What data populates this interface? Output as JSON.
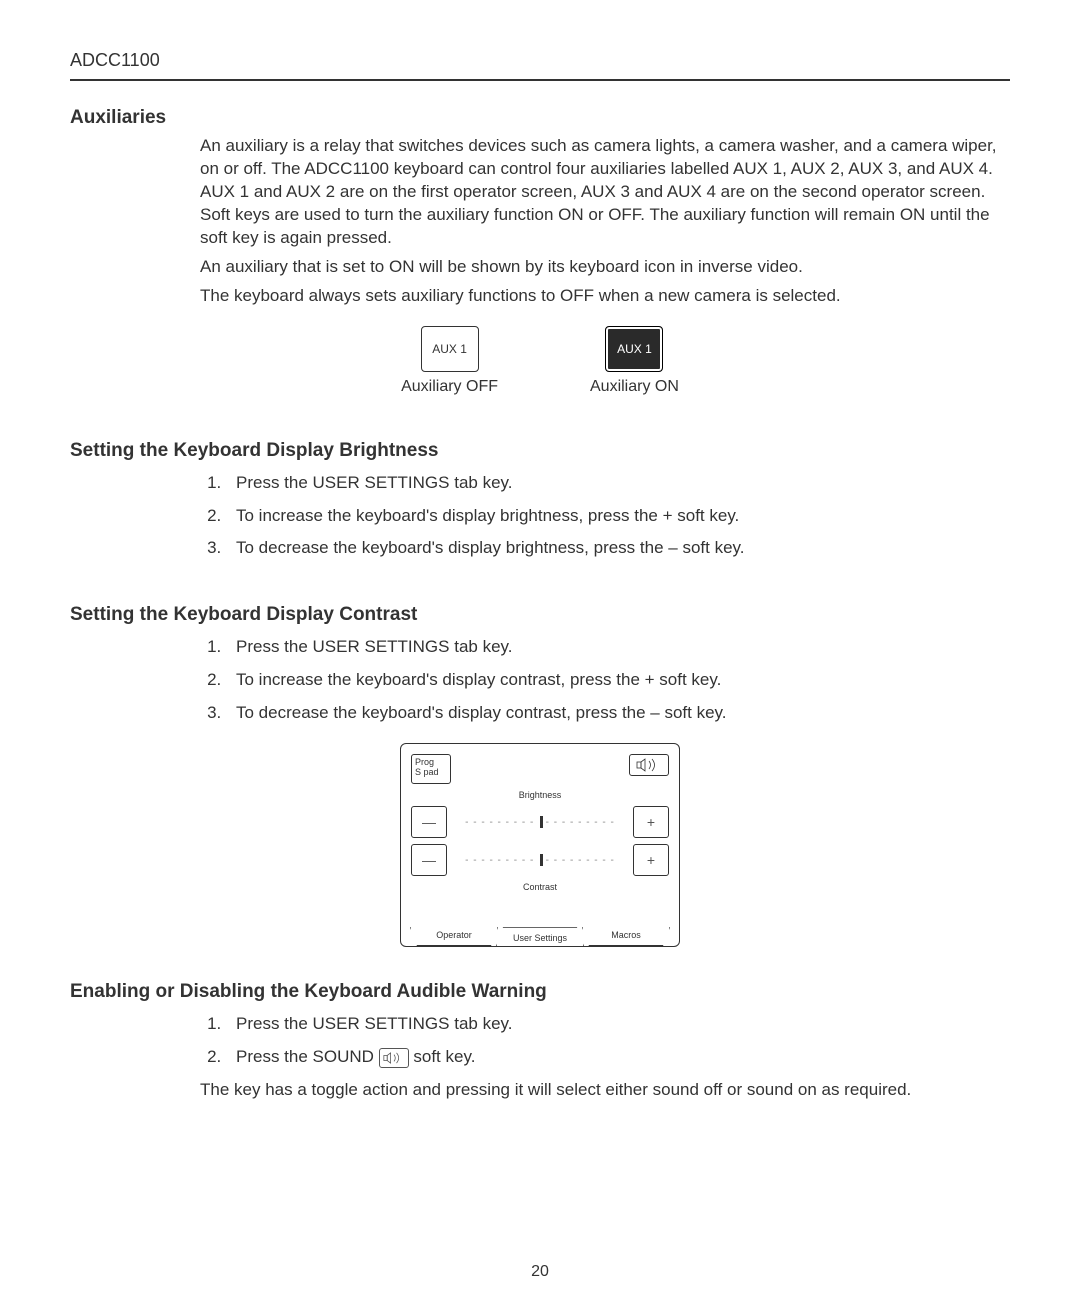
{
  "header": {
    "doc_id": "ADCC1100"
  },
  "page_number": "20",
  "sections": {
    "aux": {
      "title": "Auxiliaries",
      "p1": "An auxiliary is a relay that switches devices such as camera lights, a camera washer, and a camera wiper, on or off. The ADCC1100 keyboard can control four auxiliaries labelled AUX 1, AUX 2, AUX 3, and AUX 4. AUX 1 and AUX 2 are on the first operator screen, AUX 3 and AUX 4 are on the second operator screen. Soft keys are used to turn the auxiliary function ON or OFF. The auxiliary function will remain ON until the soft key is again pressed.",
      "p2": "An auxiliary that is set to ON will be shown by its keyboard icon in inverse video.",
      "p3": "The keyboard always sets auxiliary functions to OFF when a new camera is selected.",
      "icons": {
        "off_label": "AUX 1",
        "off_caption": "Auxiliary OFF",
        "on_label": "AUX 1",
        "on_caption": "Auxiliary ON"
      }
    },
    "brightness": {
      "title": "Setting the Keyboard Display Brightness",
      "steps": [
        "Press the USER SETTINGS tab key.",
        "To increase the keyboard's display brightness, press the + soft key.",
        "To decrease the keyboard's display brightness, press the – soft key."
      ]
    },
    "contrast": {
      "title": "Setting the Keyboard Display Contrast",
      "steps": [
        "Press the USER SETTINGS tab key.",
        "To increase the keyboard's display contrast, press the + soft key.",
        "To decrease the keyboard's display contrast, press the – soft key."
      ]
    },
    "diagram": {
      "prog": "Prog\nS pad",
      "brightness_label": "Brightness",
      "contrast_label": "Contrast",
      "minus": "—",
      "plus": "+",
      "tabs": {
        "operator": "Operator",
        "user_settings": "User Settings",
        "macros": "Macros"
      }
    },
    "audible": {
      "title": "Enabling or Disabling the Keyboard Audible Warning",
      "steps": [
        "Press the USER SETTINGS tab key.",
        "Press the SOUND "
      ],
      "step2_tail": " soft key.",
      "p1": "The key has a toggle action and pressing it will select either sound off or sound on as required."
    }
  }
}
